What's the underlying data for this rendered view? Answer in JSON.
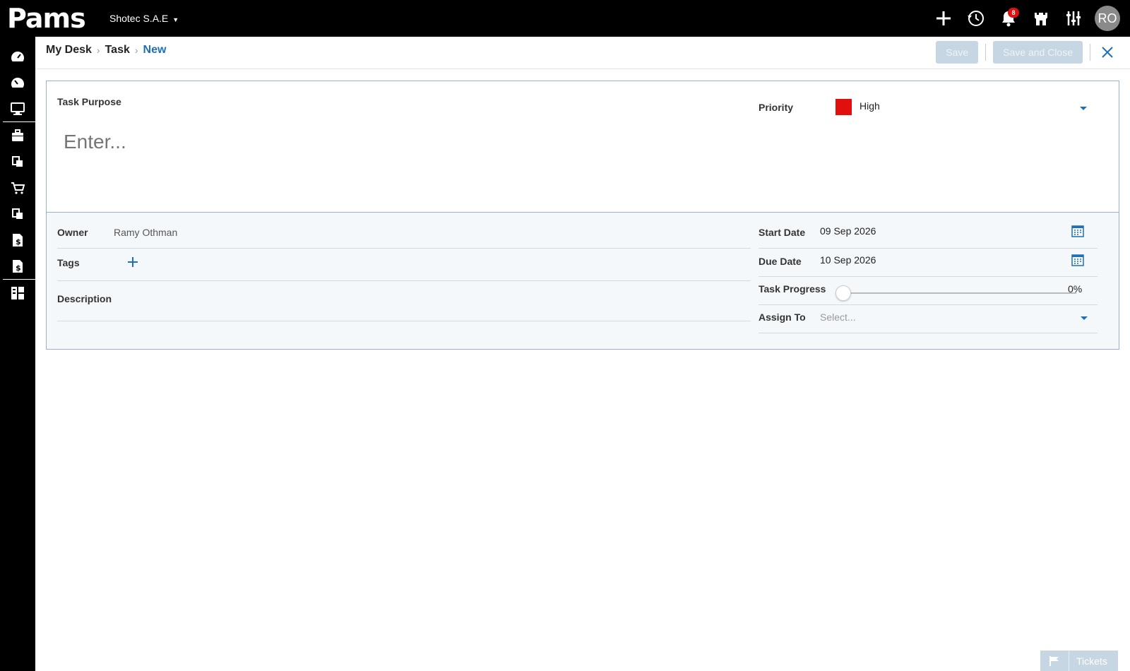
{
  "app": {
    "logo_text": "Pams",
    "company": "Shotec S.A.E",
    "user_initials": "RO",
    "notification_count": "8"
  },
  "topbar_icons": [
    "plus-icon",
    "history-icon",
    "bell-icon",
    "castle-icon",
    "sliders-icon"
  ],
  "sidebar": {
    "items": [
      "dashboard-icon",
      "dashboard-icon",
      "monitor-icon",
      "briefcase-icon",
      "documents-icon",
      "cart-icon",
      "documents-icon",
      "invoice-icon",
      "invoice-icon",
      "grid-icon"
    ]
  },
  "breadcrumb": {
    "items": [
      "My Desk",
      "Task"
    ],
    "current": "New"
  },
  "toolbar": {
    "save_label": "Save",
    "save_close_label": "Save and Close"
  },
  "form": {
    "task_purpose_label": "Task Purpose",
    "task_purpose_placeholder": "Enter...",
    "priority_label": "Priority",
    "priority_value": "High",
    "priority_color": "#e20f0f",
    "owner_label": "Owner",
    "owner_value": "Ramy Othman",
    "tags_label": "Tags",
    "description_label": "Description",
    "start_date_label": "Start Date",
    "start_date_value": "09 Sep 2026",
    "due_date_label": "Due Date",
    "due_date_value": "10 Sep 2026",
    "progress_label": "Task Progress",
    "progress_value": "0%",
    "progress_fraction": 0,
    "assign_label": "Assign To",
    "assign_placeholder": "Select..."
  },
  "tickets": {
    "label": "Tickets"
  },
  "colors": {
    "accent": "#1f6fb7",
    "topbar": "#000000",
    "disabled_button": "#c7d6e3"
  }
}
